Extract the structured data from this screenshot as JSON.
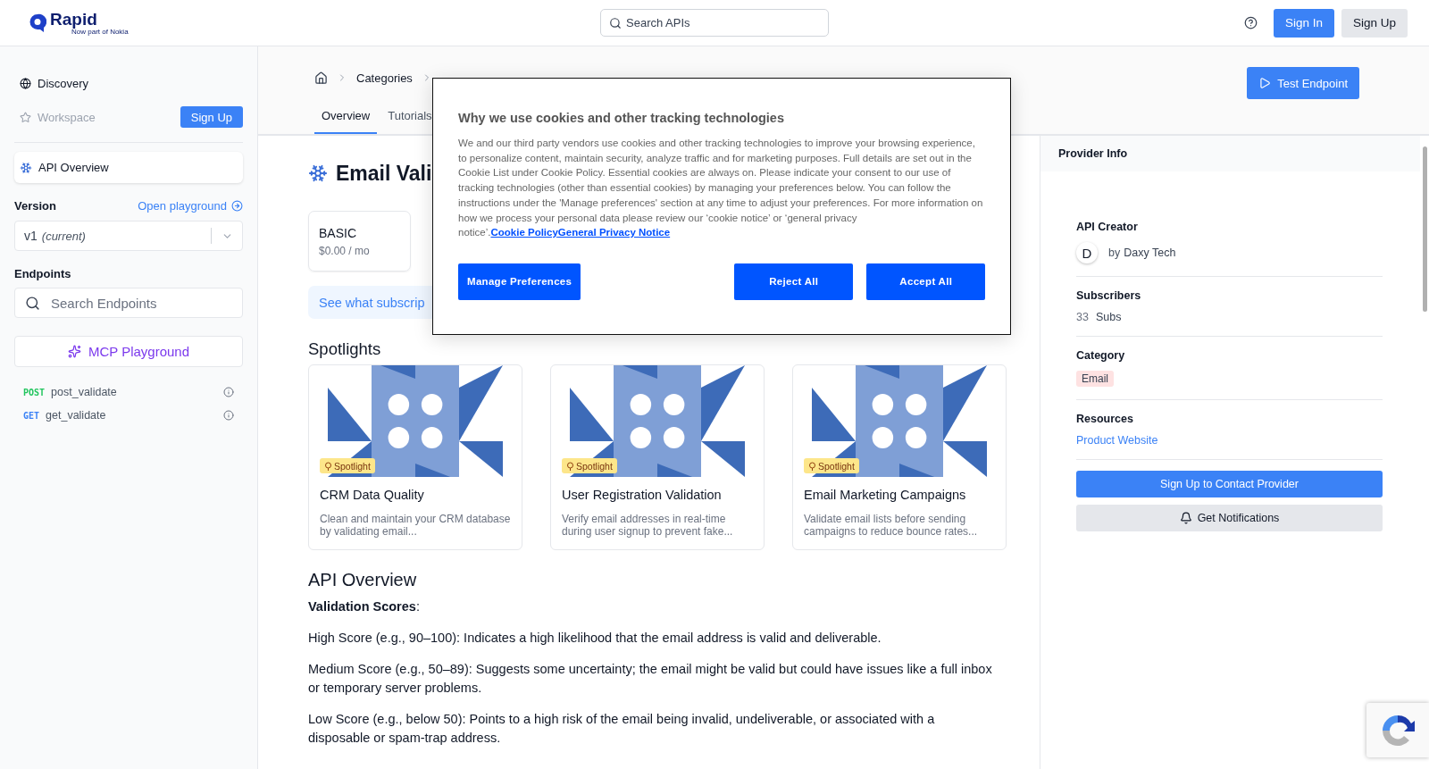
{
  "header": {
    "logo": {
      "name": "Rapid",
      "tagline": "Now part of Nokia"
    },
    "search": {
      "placeholder": "Search APIs"
    },
    "buttons": [
      {
        "label": "Sign In",
        "kind": "primary"
      },
      {
        "label": "Sign Up",
        "kind": "secondary"
      }
    ]
  },
  "sidebar": {
    "nav": [
      {
        "label": "Discovery",
        "disabled": false
      },
      {
        "label": "Workspace",
        "disabled": true
      }
    ],
    "signup_button": "Sign Up",
    "api_overview": {
      "label": "API Overview",
      "selected": true
    },
    "version": {
      "label": "Version",
      "playground_link": "Open playground",
      "value": "v1",
      "note": "(current)"
    },
    "endpoints": {
      "label": "Endpoints",
      "search": {
        "placeholder": "Search Endpoints"
      },
      "mcp_button": "MCP Playground",
      "items": [
        {
          "method": "POST",
          "name": "post_validate",
          "color": "#22c55e"
        },
        {
          "method": "GET",
          "name": "get_validate",
          "color": "#3b82f6"
        }
      ]
    }
  },
  "breadcrumb": [
    {
      "label": "Categories"
    }
  ],
  "tabs": [
    {
      "label": "Overview",
      "selected": true
    },
    {
      "label": "Tutorials",
      "selected": false
    }
  ],
  "test_button": "Test Endpoint",
  "api_title": "Email Vali",
  "plans": [
    {
      "name": "BASIC",
      "price": "$0.00 / mo"
    }
  ],
  "subscription_banner": "See what subscrip",
  "spotlights": {
    "title": "Spotlights",
    "items": [
      {
        "badge": "Spotlight",
        "title": "CRM Data Quality",
        "description": "Clean and maintain your CRM database by validating email..."
      },
      {
        "badge": "Spotlight",
        "title": "User Registration Validation",
        "description": "Verify email addresses in real-time during user signup to prevent fake..."
      },
      {
        "badge": "Spotlight",
        "title": "Email Marketing Campaigns",
        "description": "Validate email lists before sending campaigns to reduce bounce rates..."
      }
    ]
  },
  "overview": {
    "title": "API Overview",
    "heading": "Validation Scores",
    "heading_suffix": ":",
    "paragraphs": [
      "High Score (e.g., 90–100): Indicates a high likelihood that the email address is valid and deliverable.",
      "Medium Score (e.g., 50–89): Suggests some uncertainty; the email might be valid but could have issues like a full inbox or temporary server problems.",
      "Low Score (e.g., below 50): Points to a high risk of the email being invalid, undeliverable, or associated with a disposable or spam-trap address."
    ]
  },
  "provider": {
    "title": "Provider Info",
    "creator_label": "API Creator",
    "avatar": "D",
    "by": "by",
    "creator": "Daxy Tech",
    "subscribers_label": "Subscribers",
    "subscribers_count": "33",
    "subscribers_unit": "Subs",
    "category_label": "Category",
    "category": "Email",
    "resources_label": "Resources",
    "resource_link": "Product Website",
    "contact_button": "Sign Up to Contact Provider",
    "notify_button": "Get Notifications"
  },
  "cookie_dialog": {
    "title": "Why we use cookies and other tracking technologies",
    "body": "We and our third party vendors use cookies and other tracking technologies to improve your browsing experience, to personalize content, maintain security, analyze traffic and for marketing purposes. Full details are set out in the Cookie List under Cookie Policy. Essential cookies are always on. Please indicate your consent to our use of tracking technologies (other than essential cookies) by managing your preferences below. You can follow the instructions under the 'Manage preferences' section at any time to adjust your preferences. For more information on how we process your personal data please review our ‘cookie notice’ or ‘general privacy notice’.",
    "links": [
      "Cookie Policy",
      "General Privacy Notice"
    ],
    "buttons": [
      "Manage Preferences",
      "Reject All",
      "Accept All"
    ]
  }
}
